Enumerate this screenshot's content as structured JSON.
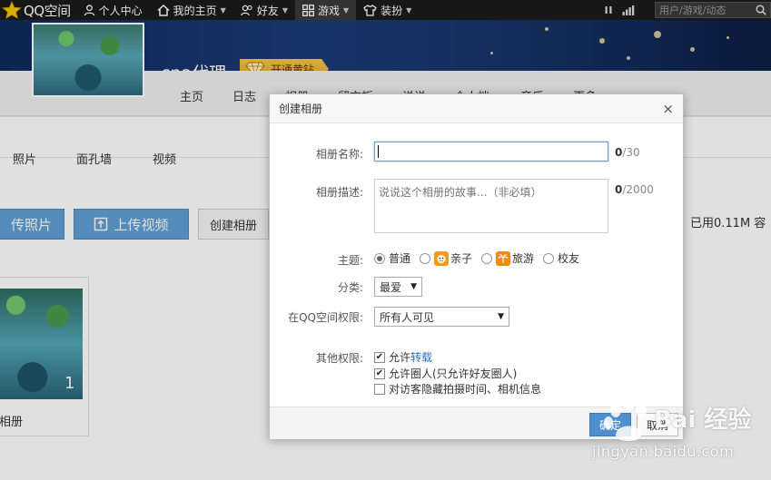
{
  "topbar": {
    "logo_text": "QQ空间",
    "nav": [
      {
        "label": "个人中心",
        "icon": "person-icon"
      },
      {
        "label": "我的主页",
        "icon": "home-icon"
      },
      {
        "label": "好友",
        "icon": "friends-icon"
      },
      {
        "label": "游戏",
        "icon": "apps-grid-icon"
      },
      {
        "label": "装扮",
        "icon": "shirt-icon"
      }
    ],
    "search_placeholder": "用户/游戏/动态"
  },
  "profile": {
    "username": "cpa代理",
    "vip_label": "开通黄钻"
  },
  "subnav": [
    "主页",
    "日志",
    "相册",
    "留言板",
    "说说",
    "个人档",
    "音乐",
    "更多"
  ],
  "content": {
    "tabs": [
      "照片",
      "面孔墙",
      "视频"
    ],
    "upload_photo_label": "传照片",
    "upload_video_label": "上传视频",
    "create_album_label": "创建相册",
    "usage_text": "已用0.11M 容",
    "album": {
      "name": "相册",
      "count": "1"
    }
  },
  "dialog": {
    "title": "创建相册",
    "close_glyph": "×",
    "name_label": "相册名称:",
    "name_value": "",
    "name_count_current": "0",
    "name_count_max": "/30",
    "desc_label": "相册描述:",
    "desc_placeholder": "说说这个相册的故事...（非必填）",
    "desc_count_current": "0",
    "desc_count_max": "/2000",
    "theme_label": "主题:",
    "themes": [
      "普通",
      "亲子",
      "旅游",
      "校友"
    ],
    "category_label": "分类:",
    "category_value": "最爱",
    "permission_label": "在QQ空间权限:",
    "permission_value": "所有人可见",
    "other_label": "其他权限:",
    "options": [
      {
        "prefix": "允许",
        "link": "转载",
        "checked": true
      },
      {
        "prefix": "允许圈人(只允许好友圈人)",
        "link": "",
        "checked": true
      },
      {
        "prefix": "对访客隐藏拍摄时间、相机信息",
        "link": "",
        "checked": false
      }
    ],
    "ok_label": "确定",
    "cancel_label": "取消"
  },
  "watermark": {
    "text1": "Bai 经验",
    "text2": "jingyan.baidu.com"
  },
  "colors": {
    "accent_blue": "#5f9fd4",
    "topbar": "#1b1b1b",
    "vip_gold": "#f5c84a"
  }
}
